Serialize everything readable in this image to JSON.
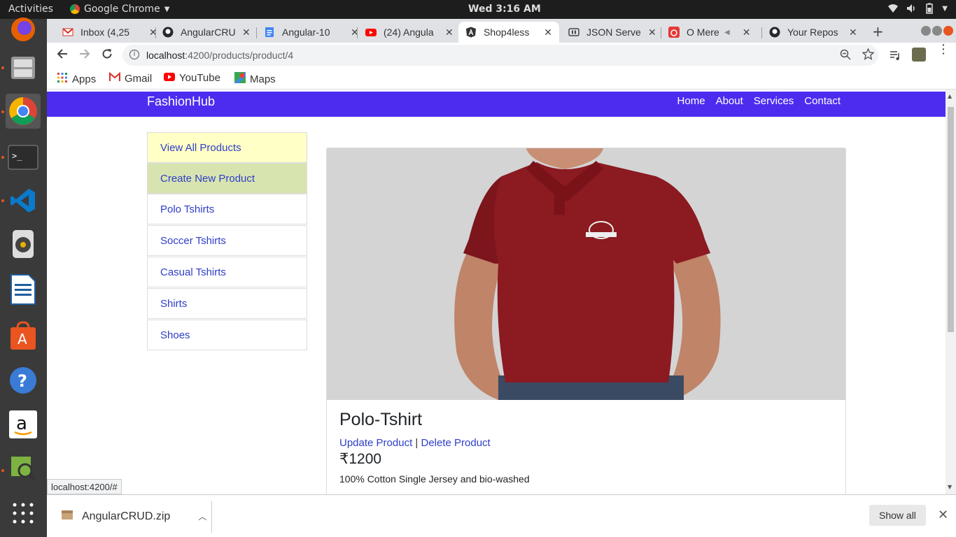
{
  "topbar": {
    "activities": "Activities",
    "app_name": "Google Chrome",
    "clock": "Wed  3:16 AM"
  },
  "tabs": [
    {
      "title": "Inbox (4,25",
      "favicon": "gmail-icon",
      "color": "#d93025"
    },
    {
      "title": "AngularCRU",
      "favicon": "github-icon",
      "color": "#24292e"
    },
    {
      "title": "Angular-10",
      "favicon": "docs-icon",
      "color": "#4285f4"
    },
    {
      "title": "(24) Angula",
      "favicon": "youtube-icon",
      "color": "#ff0000"
    },
    {
      "title": "Shop4less",
      "favicon": "angular-icon",
      "color": "#333333",
      "active": true
    },
    {
      "title": "JSON Serve",
      "favicon": "json-server-icon",
      "color": "#444444"
    },
    {
      "title": "O Mere",
      "favicon": "music-icon",
      "color": "#e53935"
    },
    {
      "title": "Your Repos",
      "favicon": "github-icon",
      "color": "#24292e"
    }
  ],
  "address": {
    "host": "localhost",
    "path": ":4200/products/product/4"
  },
  "bookmarks": [
    {
      "label": "Apps",
      "icon": "apps-grid-icon"
    },
    {
      "label": "Gmail",
      "icon": "gmail-icon"
    },
    {
      "label": "YouTube",
      "icon": "youtube-icon"
    },
    {
      "label": "Maps",
      "icon": "maps-icon"
    }
  ],
  "site": {
    "brand": "FashionHub",
    "nav": [
      "Home",
      "About",
      "Services",
      "Contact"
    ],
    "nav_color": "#4d2cf0"
  },
  "sidebar": {
    "items": [
      "View All Products",
      "Create New Product",
      "Polo Tshirts",
      "Soccer Tshirts",
      "Casual Tshirts",
      "Shirts",
      "Shoes"
    ]
  },
  "product": {
    "title": "Polo-Tshirt",
    "update_label": "Update Product",
    "separator": "|",
    "delete_label": "Delete Product",
    "price": "₹1200",
    "description": "100% Cotton Single Jersey and bio-washed",
    "image": "maroon-polo-tshirt",
    "shirt_color": "#8b1a21"
  },
  "status_url": "localhost:4200/#",
  "downloads": {
    "file": "AngularCRUD.zip",
    "show_all": "Show all"
  }
}
